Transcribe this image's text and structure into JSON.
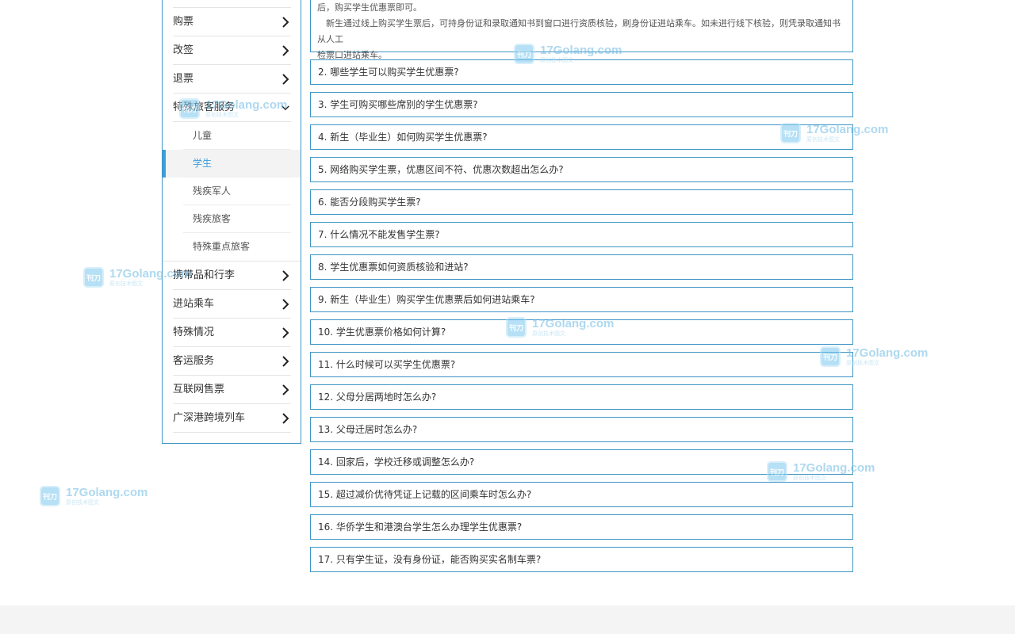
{
  "sidebar": {
    "items_top": [
      {
        "label": "购票"
      },
      {
        "label": "改签"
      },
      {
        "label": "退票"
      }
    ],
    "expanded": {
      "label": "特殊旅客服务",
      "children": [
        {
          "label": "儿童"
        },
        {
          "label": "学生"
        },
        {
          "label": "残疾军人"
        },
        {
          "label": "残疾旅客"
        },
        {
          "label": "特殊重点旅客"
        }
      ],
      "active_index": 1
    },
    "items_bottom": [
      {
        "label": "携带品和行李"
      },
      {
        "label": "进站乘车"
      },
      {
        "label": "特殊情况"
      },
      {
        "label": "客运服务"
      },
      {
        "label": "互联网售票"
      },
      {
        "label": "广深港跨境列车"
      }
    ]
  },
  "faq": {
    "intro": {
      "line1": "后，购买学生优惠票即可。",
      "line2": "新生通过线上购买学生票后，可持身份证和录取通知书到窗口进行资质核验，刷身份证进站乘车。如未进行线下核验，则凭录取通知书从人工",
      "line3": "检票口进站乘车。"
    },
    "questions": [
      "2. 哪些学生可以购买学生优惠票?",
      "3. 学生可购买哪些席别的学生优惠票?",
      "4. 新生（毕业生）如何购买学生优惠票?",
      "5. 网络购买学生票，优惠区间不符、优惠次数超出怎么办?",
      "6. 能否分段购买学生票?",
      "7. 什么情况不能发售学生票?",
      "8. 学生优惠票如何资质核验和进站?",
      "9. 新生（毕业生）购买学生优惠票后如何进站乘车?",
      "10. 学生优惠票价格如何计算?",
      "11. 什么时候可以买学生优惠票?",
      "12. 父母分居两地时怎么办?",
      "13. 父母迁居时怎么办?",
      "14. 回家后，学校迁移或调整怎么办?",
      "15. 超过减价优待凭证上记载的区间乘车时怎么办?",
      "16. 华侨学生和港澳台学生怎么办理学生优惠票?",
      "17. 只有学生证，没有身份证，能否购买实名制车票?"
    ]
  },
  "watermark": {
    "logo_text": "刊刀",
    "brand": "17Golang.com",
    "sub": "原创技术图文"
  },
  "colors": {
    "border_blue": "#3f95c6",
    "active_blue": "#3b9fd9",
    "footer_gray": "#f4f4f4"
  }
}
